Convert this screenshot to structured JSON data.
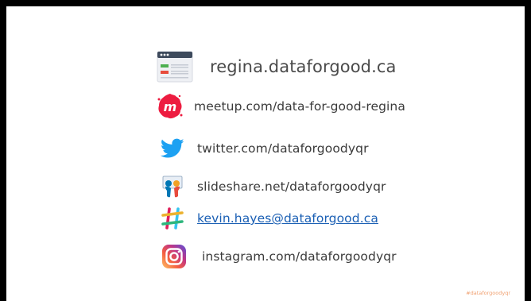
{
  "contacts": {
    "website": {
      "text": "regina.dataforgood.ca",
      "icon": "browser-window-icon"
    },
    "meetup": {
      "text": "meetup.com/data-for-good-regina",
      "icon": "meetup-icon",
      "color": "#ed1c40"
    },
    "twitter": {
      "text": "twitter.com/dataforgoodyqr",
      "icon": "twitter-bird-icon",
      "color": "#1da1f2"
    },
    "slideshare": {
      "text": "slideshare.net/dataforgoodyqr",
      "icon": "slideshare-icon",
      "color": "#0077b5"
    },
    "slack": {
      "text": "kevin.hayes@dataforgood.ca",
      "icon": "slack-icon"
    },
    "instagram": {
      "text": "instagram.com/dataforgoodyqr",
      "icon": "instagram-icon"
    }
  },
  "footer": {
    "hashtag": "#dataforgoodyqr",
    "color": "#f0a070"
  }
}
